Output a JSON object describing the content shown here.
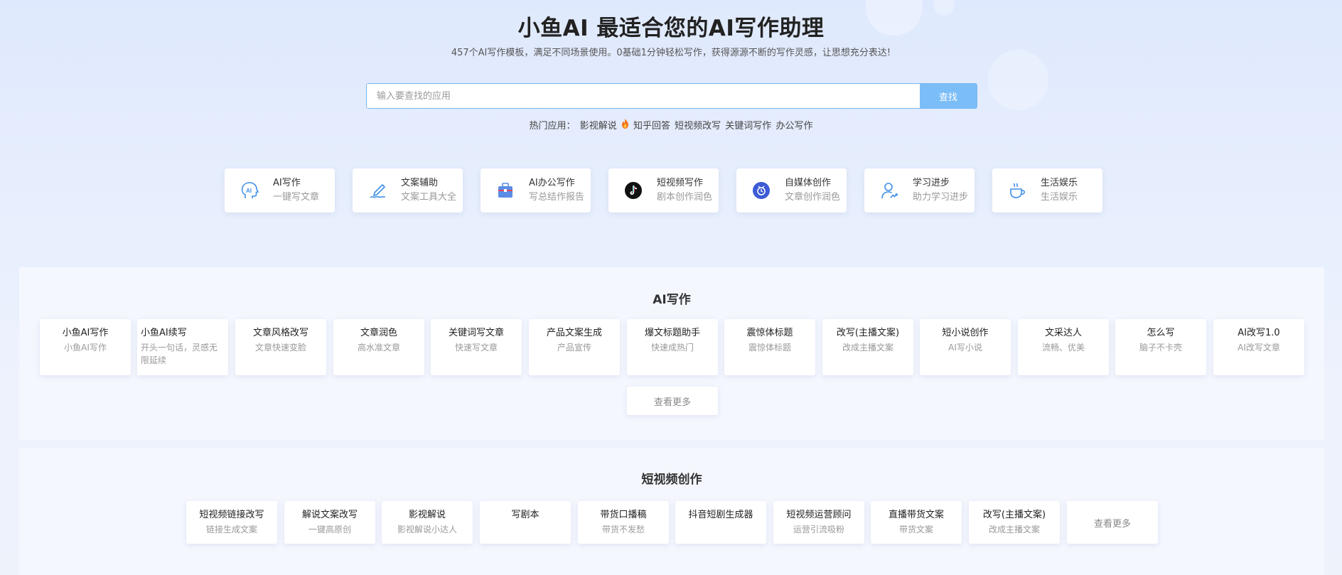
{
  "hero": {
    "title": "小鱼AI 最适合您的AI写作助理",
    "subtitle": "457个AI写作模板，满足不同场景使用。0基础1分钟轻松写作，获得源源不断的写作灵感，让思想充分表达!"
  },
  "search": {
    "placeholder": "输入要查找的应用",
    "value": "",
    "button_label": "查找"
  },
  "hot": {
    "label": "热门应用：",
    "items": [
      "影视解说",
      "知乎回答",
      "短视频改写",
      "关键词写作",
      "办公写作"
    ]
  },
  "categories": [
    {
      "name": "AI写作",
      "desc": "一键写文章",
      "icon": "ai-head-icon"
    },
    {
      "name": "文案辅助",
      "desc": "文案工具大全",
      "icon": "pen-write-icon"
    },
    {
      "name": "AI办公写作",
      "desc": "写总结作报告",
      "icon": "briefcase-icon"
    },
    {
      "name": "短视频写作",
      "desc": "剧本创作润色",
      "icon": "tiktok-icon"
    },
    {
      "name": "自媒体创作",
      "desc": "文章创作润色",
      "icon": "media-icon"
    },
    {
      "name": "学习进步",
      "desc": "助力学习进步",
      "icon": "user-growth-icon"
    },
    {
      "name": "生活娱乐",
      "desc": "生活娱乐",
      "icon": "coffee-cup-icon"
    }
  ],
  "section_ai": {
    "title": "AI写作",
    "tools": [
      {
        "name": "小鱼AI写作",
        "desc": "小鱼AI写作"
      },
      {
        "name": "小鱼AI续写",
        "desc": "开头一句话，灵感无限延续"
      },
      {
        "name": "文章风格改写",
        "desc": "文章快速变脸"
      },
      {
        "name": "文章润色",
        "desc": "高水准文章"
      },
      {
        "name": "关键词写文章",
        "desc": "快速写文章"
      },
      {
        "name": "产品文案生成",
        "desc": "产品宣传"
      },
      {
        "name": "爆文标题助手",
        "desc": "快速成热门"
      },
      {
        "name": "震惊体标题",
        "desc": "震惊体标题"
      },
      {
        "name": "改写(主播文案)",
        "desc": "改成主播文案"
      },
      {
        "name": "短小说创作",
        "desc": "AI写小说"
      },
      {
        "name": "文采达人",
        "desc": "流畅、优美"
      },
      {
        "name": "怎么写",
        "desc": "脑子不卡壳"
      },
      {
        "name": "AI改写1.0",
        "desc": "AI改写文章"
      }
    ],
    "more_label": "查看更多"
  },
  "section_video": {
    "title": "短视频创作",
    "tools": [
      {
        "name": "短视频链接改写",
        "desc": "链接生成文案"
      },
      {
        "name": "解说文案改写",
        "desc": "一键高原创"
      },
      {
        "name": "影视解说",
        "desc": "影视解说小达人"
      },
      {
        "name": "写剧本",
        "desc": ""
      },
      {
        "name": "带货口播稿",
        "desc": "带货不发愁"
      },
      {
        "name": "抖音短剧生成器",
        "desc": ""
      },
      {
        "name": "短视频运营顾问",
        "desc": "运营引流吸粉"
      },
      {
        "name": "直播带货文案",
        "desc": "带货文案"
      },
      {
        "name": "改写(主播文案)",
        "desc": "改成主播文案"
      }
    ],
    "more_label": "查看更多"
  },
  "colors": {
    "accent": "#7bbdf6",
    "border": "#79b6f3",
    "icon_blue": "#3e8ee8",
    "media_blue": "#3d5bd6"
  }
}
